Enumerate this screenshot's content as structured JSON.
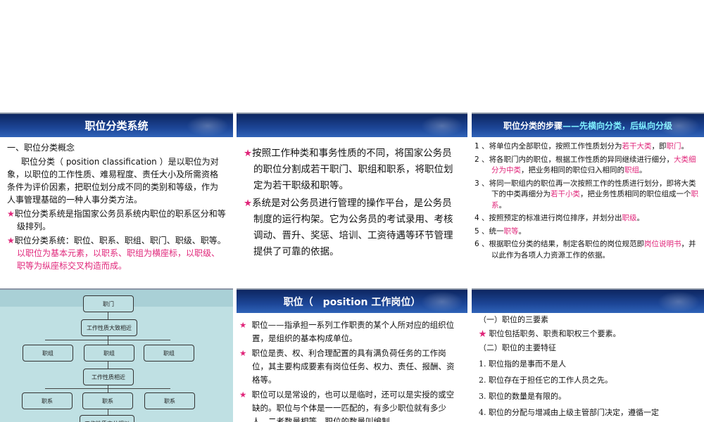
{
  "s1": {
    "title": "职位分类系统",
    "h": "一、职位分类概念",
    "p1": "职位分类（ position classification ）是以职位为对象，以职位的工作性质、难易程度、责任大小及所需资格条件为评价因素，把职位划分成不同的类别和等级，作为人事管理基础的一种人事分类方法。",
    "b1": "职位分类系统是指国家公务员系统内职位的职系区分和等级排列。",
    "b2a": "职位分类系统：职位、职系、职组、职门、职级、职等。",
    "b2b": "以职位为基本元素，以职系、职组为横座标，以职级、职等为纵座标交叉构造而成。"
  },
  "s2": {
    "b1": "按照工作种类和事务性质的不同，将国家公务员的职位分割成若干职门、职组和职系，将职位划定为若干职级和职等。",
    "b2": "系统是对公务员进行管理的操作平台，是公务员制度的运行构架。它为公务员的考试录用、考核调动、晋升、奖惩、培训、工资待遇等环节管理提供了可靠的依据。"
  },
  "s3": {
    "title_a": "职位分类的步骤",
    "title_b": "——先横向分类，后纵向分级",
    "i1": [
      "1 、将单位内全部职位，按照工作性质划分为",
      "若干大类",
      "，即",
      "职门",
      "。"
    ],
    "i2": [
      "2 、将各职门内的职位，根据工作性质的异同继续进行细分，",
      "大类细分为中类",
      "，把业务相同的职位归入相同的",
      "职组",
      "。"
    ],
    "i3": [
      "3 、将同一职组内的职位再一次按照工作的性质进行划分，即将大类下的中类再细分为",
      "若干小类",
      "，把业务性质相同的职位组成一个",
      "职系",
      "。"
    ],
    "i4": [
      "4 、按照预定的标准进行岗位排序，并划分出",
      "职级",
      "。"
    ],
    "i5": [
      "5 、统一",
      "职等",
      "。"
    ],
    "i6": [
      "6 、根据职位分类的结果，制定各职位的岗位规范即",
      "岗位说明书",
      "，并以此作为各项人力资源工作的依据。"
    ]
  },
  "s4": {
    "top": "职门",
    "n1": "工作性质大致相近",
    "g": [
      "职组",
      "职组",
      "职组"
    ],
    "n2": "工作性质相近",
    "x": [
      "职系",
      "职系",
      "职系"
    ],
    "n3": "工作性质充分相似"
  },
  "s5": {
    "title": "职位（　position 工作岗位）",
    "b": [
      "职位——指承担一系列工作职责的某个人所对应的组织位置，是组织的基本构成单位。",
      "职位是责、权、利合理配置的具有满负荷任务的工作岗位，其主要构成要素有岗位任务、权力、责任、报酬、资格等。",
      "职位可以是常设的，也可以是临时，还可以是实授的或空缺的。职位与个体是一一匹配的，有多少职位就有多少人，二者数量相等。职位的数量叫编制。"
    ]
  },
  "s6": {
    "h1": "（一）职位的三要素",
    "b": "职位包括职务、职责和职权三个要素。",
    "h2": "（二）职位的主要特征",
    "l": [
      "1. 职位指的是事而不是人",
      "2. 职位存在于担任它的工作人员之先。",
      "3. 职位的数量是有限的。",
      "4. 职位的分配与增减由上级主管部门决定，遵循一定"
    ]
  },
  "star": "★"
}
